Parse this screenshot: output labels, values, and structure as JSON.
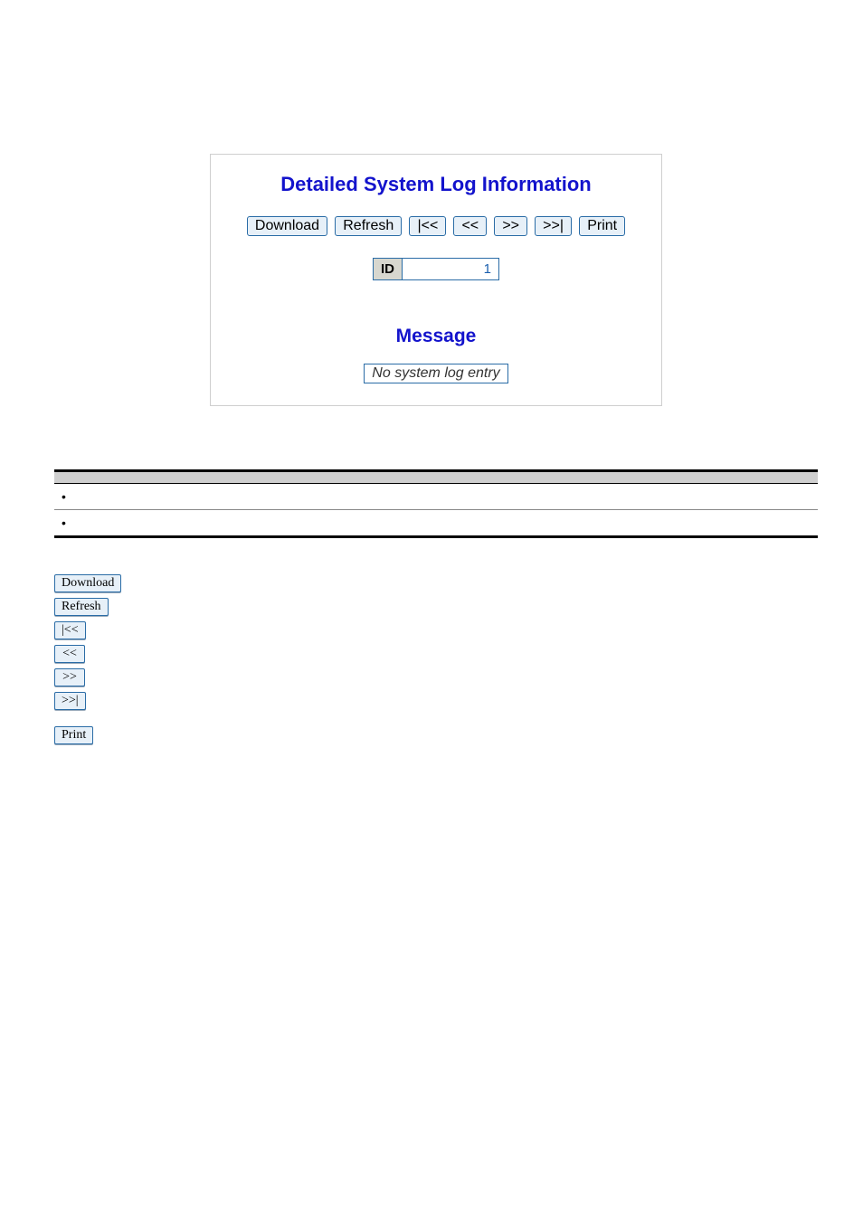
{
  "page_number": "",
  "panel": {
    "title": "Detailed System Log Information",
    "buttons": {
      "download": "Download",
      "refresh": "Refresh",
      "first": "|<<",
      "prev": "<<",
      "next": ">>",
      "last": ">>|",
      "print": "Print"
    },
    "id_label": "ID",
    "id_value": "1",
    "message_heading": "Message",
    "message_content": "No system log entry"
  },
  "figure_caption": "",
  "table": {
    "headers": [
      "",
      ""
    ],
    "rows": [
      {
        "object": "",
        "description": ""
      },
      {
        "object": "",
        "description": ""
      }
    ]
  },
  "buttons_section": {
    "header": "",
    "intro": "",
    "items": [
      {
        "label": "Download",
        "desc": ""
      },
      {
        "label": "Refresh",
        "desc": ""
      },
      {
        "label": "|<<",
        "desc": ""
      },
      {
        "label": "<<",
        "desc": ""
      },
      {
        "label": ">>",
        "desc": ""
      },
      {
        "label": ">>|",
        "desc": ""
      },
      {
        "label": "Print",
        "desc": ""
      }
    ]
  }
}
